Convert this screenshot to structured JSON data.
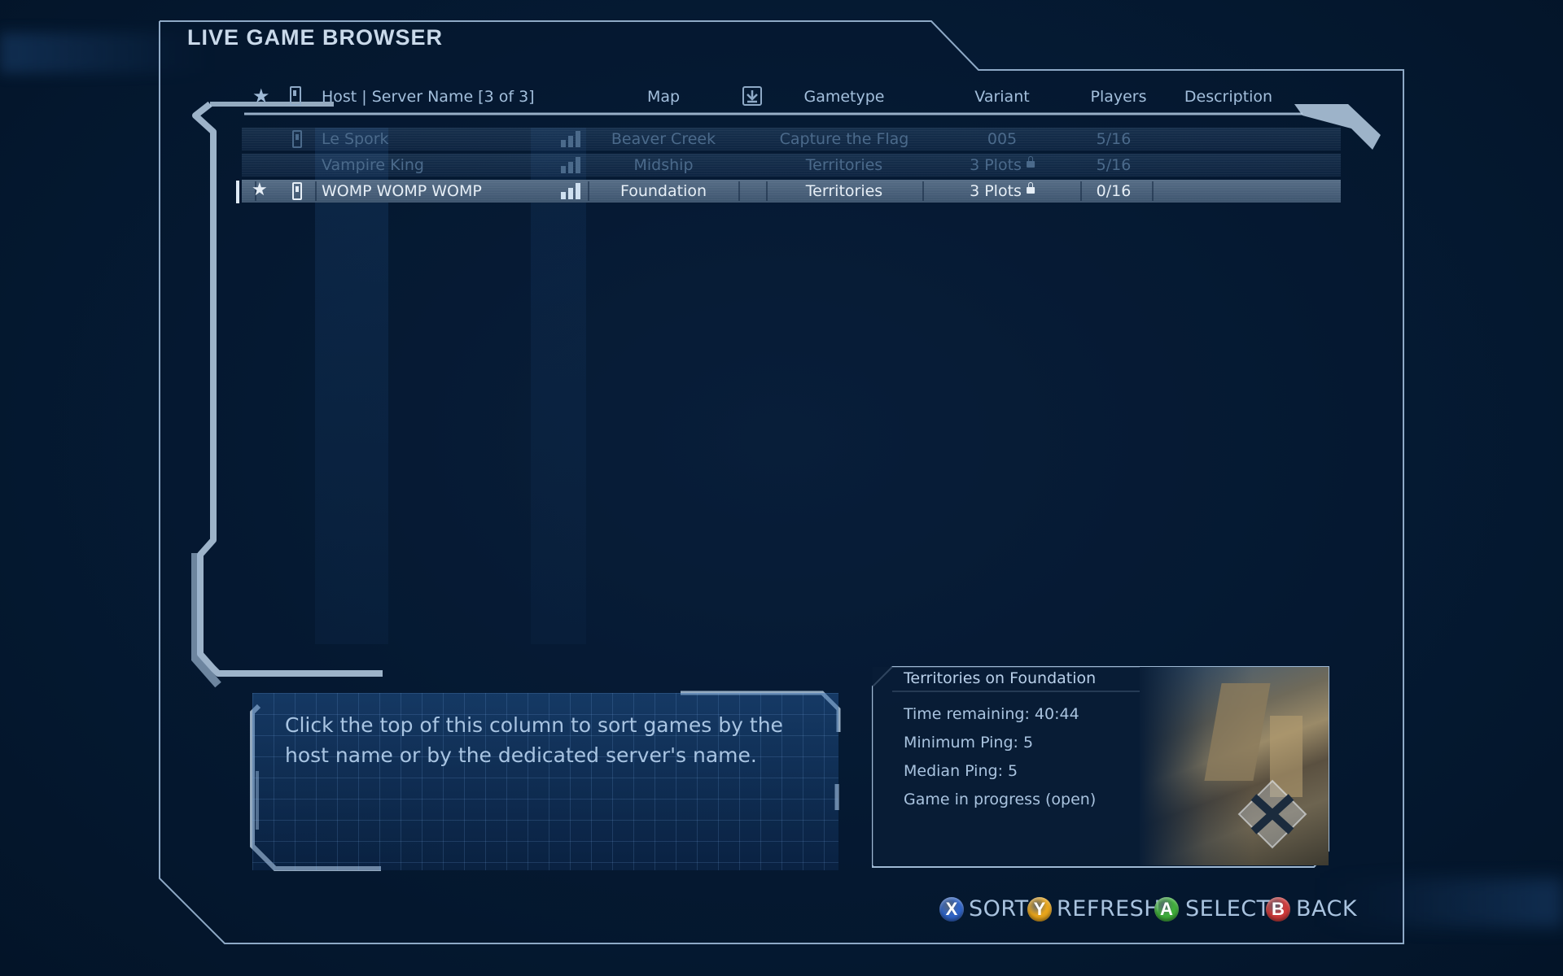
{
  "window": {
    "title": "LIVE GAME BROWSER"
  },
  "headers": {
    "host_server": "Host | Server Name [3 of 3]",
    "map": "Map",
    "gametype": "Gametype",
    "variant": "Variant",
    "players": "Players",
    "description": "Description"
  },
  "icons": {
    "favorite": "star-icon",
    "device": "phone-icon",
    "download": "download-icon",
    "signal": "signal-bars-icon",
    "lock": "lock-icon"
  },
  "rows": [
    {
      "host": "Le Spork",
      "map": "Beaver Creek",
      "gametype": "Capture the Flag",
      "variant": "005",
      "players": "5/16",
      "state": "dim",
      "favorite": false,
      "locked": false
    },
    {
      "host": "Vampire King",
      "map": "Midship",
      "gametype": "Territories",
      "variant": "3 Plots",
      "players": "5/16",
      "state": "dim",
      "favorite": false,
      "locked": true
    },
    {
      "host": "WOMP WOMP WOMP",
      "map": "Foundation",
      "gametype": "Territories",
      "variant": "3 Plots",
      "players": "0/16",
      "state": "selected",
      "favorite": true,
      "locked": true
    }
  ],
  "help": {
    "text": "Click the top of this column to sort games by the host name or by the dedicated server's name."
  },
  "info": {
    "title": "Territories on Foundation",
    "time_remaining": "Time remaining: 40:44",
    "min_ping": "Minimum Ping: 5",
    "median_ping": "Median Ping: 5",
    "status": "Game in progress (open)"
  },
  "buttons": [
    {
      "key": "X",
      "label": "SORT",
      "color": "#2f64c8"
    },
    {
      "key": "Y",
      "label": "REFRESH",
      "color": "#e8a51c"
    },
    {
      "key": "A",
      "label": "SELECT",
      "color": "#3fae3a"
    },
    {
      "key": "B",
      "label": "BACK",
      "color": "#cf3a3a"
    }
  ],
  "colors": {
    "accent": "#a9c3df",
    "frame": "#9bb6d1",
    "selected_row": "#566d86"
  }
}
